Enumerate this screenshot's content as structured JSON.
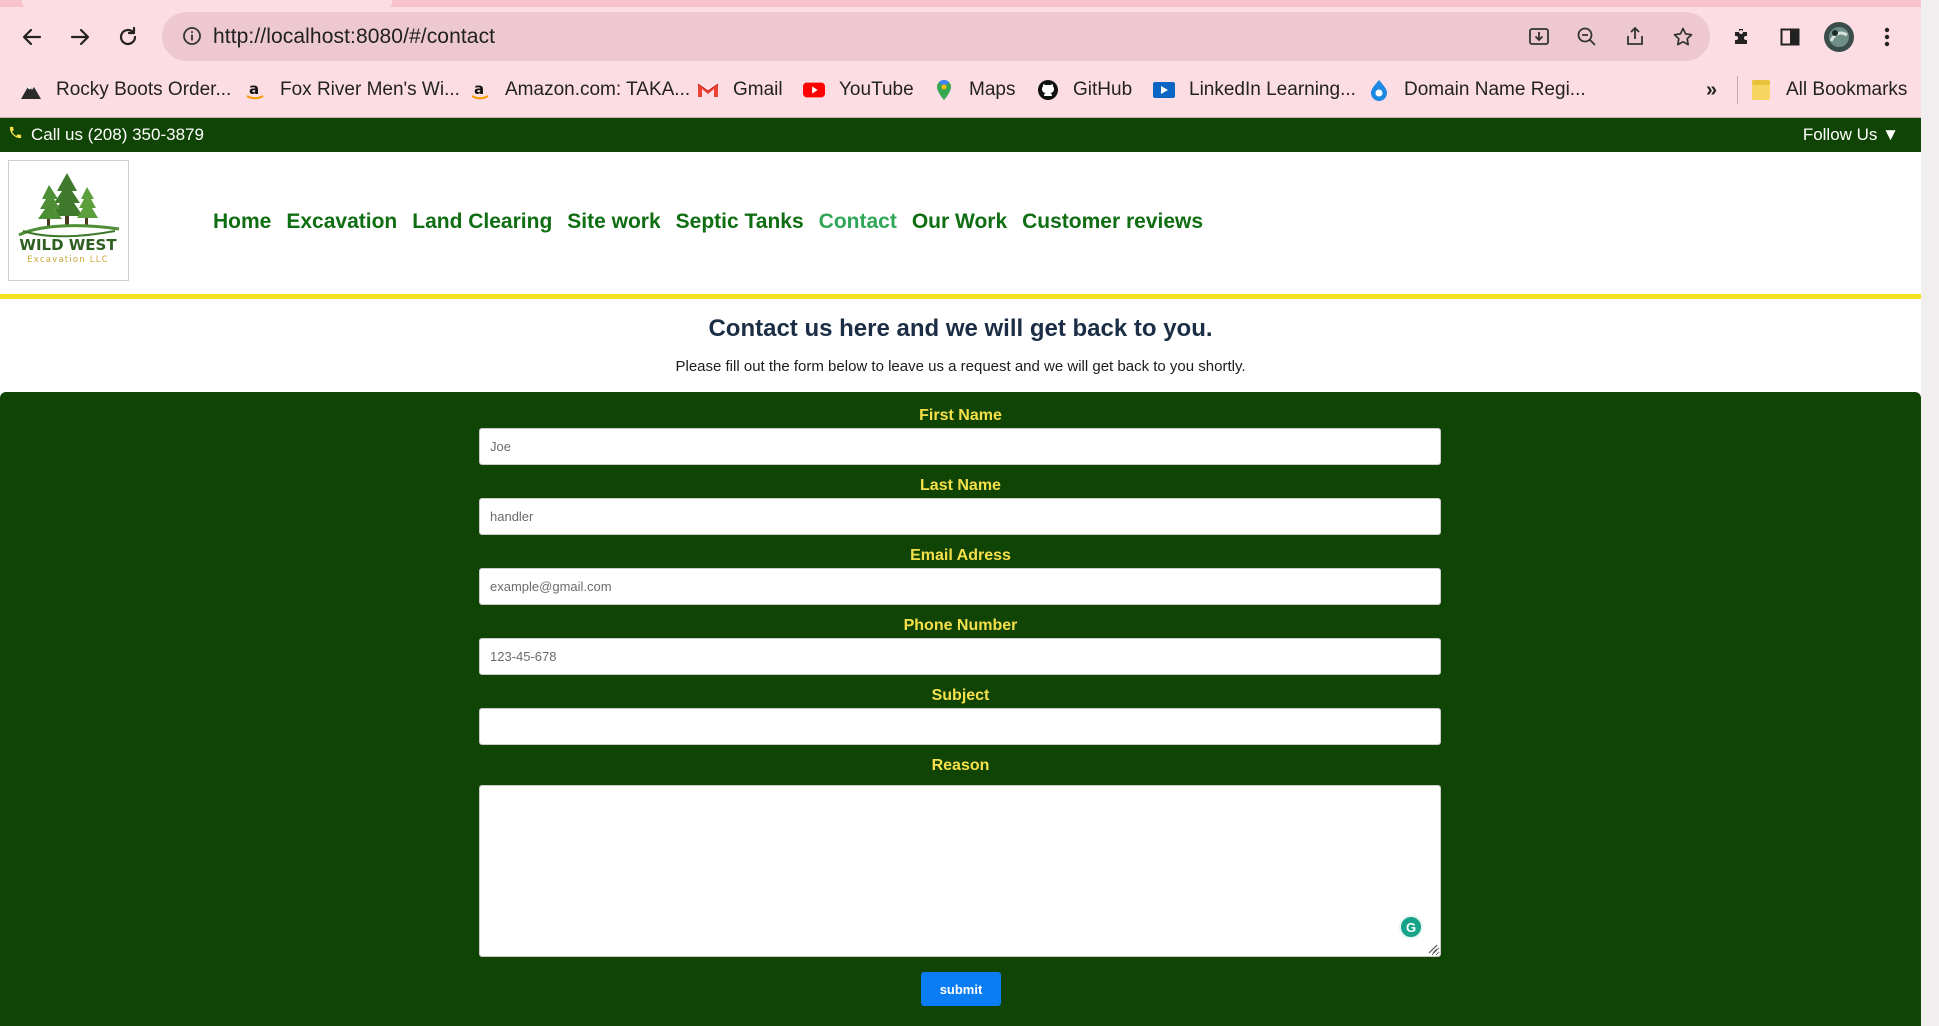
{
  "browser": {
    "url": "http://localhost:8080/#/contact",
    "bookmarks": [
      {
        "label": "Rocky Boots Order...",
        "icon": "mountain-icon"
      },
      {
        "label": "Fox River Men's Wi...",
        "icon": "amazon-icon"
      },
      {
        "label": "Amazon.com: TAKA...",
        "icon": "amazon-icon"
      },
      {
        "label": "Gmail",
        "icon": "gmail-icon"
      },
      {
        "label": "YouTube",
        "icon": "youtube-icon"
      },
      {
        "label": "Maps",
        "icon": "maps-pin-icon"
      },
      {
        "label": "GitHub",
        "icon": "github-icon"
      },
      {
        "label": "LinkedIn Learning...",
        "icon": "play-icon"
      },
      {
        "label": "Domain Name Regi...",
        "icon": "domain-icon"
      }
    ],
    "overflow_label": "»",
    "all_bookmarks_label": "All Bookmarks"
  },
  "topbar": {
    "call_text": "Call us (208) 350-3879",
    "follow_text": "Follow Us ▼"
  },
  "logo": {
    "name": "WILD WEST",
    "tagline": "Excavation LLC"
  },
  "nav": {
    "items": [
      {
        "label": "Home",
        "active": false
      },
      {
        "label": "Excavation",
        "active": false
      },
      {
        "label": "Land Clearing",
        "active": false
      },
      {
        "label": "Site work",
        "active": false
      },
      {
        "label": "Septic Tanks",
        "active": false
      },
      {
        "label": "Contact",
        "active": true
      },
      {
        "label": "Our Work",
        "active": false
      },
      {
        "label": "Customer reviews",
        "active": false
      }
    ]
  },
  "intro": {
    "title": "Contact us here and we will get back to you.",
    "subtitle": "Please fill out the form below to leave us a request and we will get back to you shortly."
  },
  "form": {
    "first_name": {
      "label": "First Name",
      "placeholder": "Joe",
      "value": ""
    },
    "last_name": {
      "label": "Last Name",
      "placeholder": "handler",
      "value": ""
    },
    "email": {
      "label": "Email Adress",
      "placeholder": "example@gmail.com",
      "value": ""
    },
    "phone": {
      "label": "Phone Number",
      "placeholder": "123-45-678",
      "value": ""
    },
    "subject": {
      "label": "Subject",
      "placeholder": "",
      "value": ""
    },
    "reason": {
      "label": "Reason",
      "placeholder": "",
      "value": ""
    },
    "submit_label": "submit"
  },
  "colors": {
    "brand_green": "#104404",
    "nav_green": "#0f6d12",
    "nav_active": "#2fa757",
    "accent_yellow": "#f2e21f",
    "label_yellow": "#f5e04a",
    "submit_blue": "#0a7cf4"
  }
}
